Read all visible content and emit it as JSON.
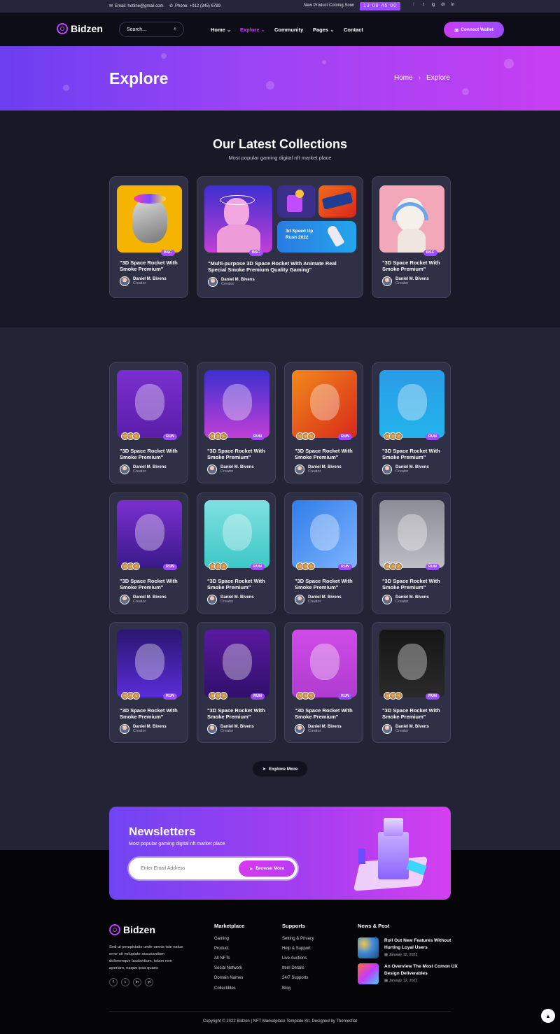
{
  "topbar": {
    "email": "Email: hotline@gmail.com",
    "phone": "Phone: +012 (345) 6789",
    "coming_soon": "New Product Coming Soon",
    "timer": "13 08 45 00",
    "social": [
      "f",
      "t",
      "ig",
      "dr",
      "in"
    ]
  },
  "brand": {
    "name": "Bidzen"
  },
  "nav": {
    "search_placeholder": "Search...",
    "items": [
      "Home",
      "Explore",
      "Community",
      "Pages",
      "Contact"
    ],
    "connect": "Connect Wallet"
  },
  "hero": {
    "title": "Explore",
    "crumb_home": "Home",
    "crumb_sep": "›",
    "crumb_current": "Explore"
  },
  "collections": {
    "title": "Our Latest Collections",
    "subtitle": "Most popular gaming digital nft market place",
    "items": [
      {
        "name": "\"3D Space Rocket With Smoke Premium\"",
        "tag": "BSC",
        "creator": "Daniel M. Bivens",
        "role": "Creator"
      },
      {
        "name": "\"Multi-purpose 3D Space Rocket With Animate Real Special Smoke Premium Quality Gaming\"",
        "tag": "BSC",
        "creator": "Daniel M. Bivens",
        "role": "Creator",
        "promo": "3d Speed Up Rush 2022"
      },
      {
        "name": "\"3D Space Rocket With Smoke Premium\"",
        "tag": "BSC",
        "creator": "Daniel M. Bivens",
        "role": "Creator"
      }
    ]
  },
  "grid": {
    "tag": "RUN",
    "name": "\"3D Space Rocket With Smoke Premium\"",
    "creator": "Daniel M. Bivens",
    "role": "Creator",
    "explore_more": "Explore More"
  },
  "newsletter": {
    "title": "Newsletters",
    "subtitle": "Most popular gaming digital nft market place",
    "placeholder": "Enter Email Address",
    "button": "Browse More"
  },
  "footer": {
    "description": "Sed ut perspiciatis unde omnis iste natus error sit voluptate accusantium doloremque laudantium, totam rem aperiam, eaque ipsa quaes",
    "social": [
      "f",
      "t",
      "in",
      "yt"
    ],
    "marketplace": {
      "title": "Marketplace",
      "links": [
        "Gaming",
        "Product",
        "All NFTs",
        "Social Network",
        "Domain Names",
        "Collectibles"
      ]
    },
    "supports": {
      "title": "Supports",
      "links": [
        "Setting & Privacy",
        "Help & Support",
        "Live Auctions",
        "Item Details",
        "24/7 Supports",
        "Blog"
      ]
    },
    "news": {
      "title": "News & Post",
      "posts": [
        {
          "title": "Roll Out New Features Without Hurting Loyal Users",
          "date": "January 12, 2022"
        },
        {
          "title": "An Overview The Most Comon UX Design Deliverables",
          "date": "January 12, 2022"
        }
      ]
    },
    "copyright": "Copyright © 2022 Bidzen | NFT Marketplace Template Kit. Designed by Themesflat"
  },
  "colors": {
    "accent": "#9d4bff",
    "accent2": "#c83cf5",
    "bg": "#141420"
  }
}
